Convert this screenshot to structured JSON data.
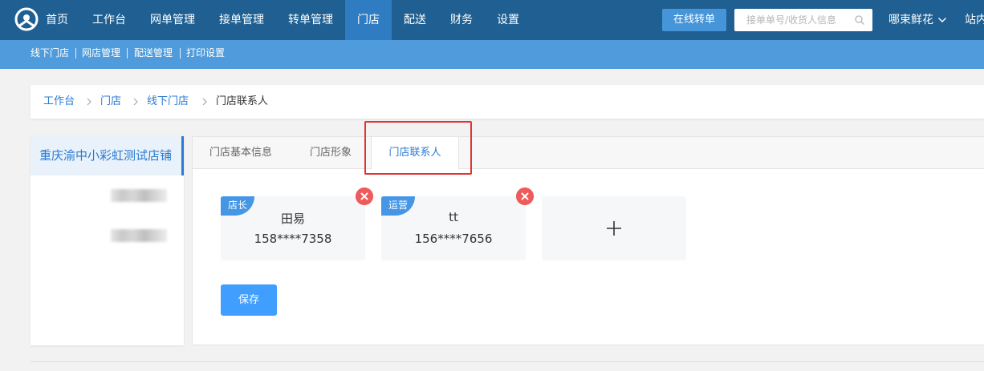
{
  "nav": {
    "items": [
      {
        "label": "首页"
      },
      {
        "label": "工作台"
      },
      {
        "label": "网单管理"
      },
      {
        "label": "接单管理"
      },
      {
        "label": "转单管理"
      },
      {
        "label": "门店",
        "active": true
      },
      {
        "label": "配送"
      },
      {
        "label": "财务"
      },
      {
        "label": "设置"
      }
    ],
    "online_transfer_button": "在线转单",
    "search": {
      "placeholder": "接单单号/收货人信息",
      "value": ""
    },
    "shop_name": "哪束鲜花",
    "station_label": "站内"
  },
  "subnav": {
    "items": [
      {
        "label": "线下门店"
      },
      {
        "label": "网店管理"
      },
      {
        "label": "配送管理"
      },
      {
        "label": "打印设置"
      }
    ]
  },
  "breadcrumb": [
    "工作台",
    "门店",
    "线下门店",
    "门店联系人"
  ],
  "store_list": {
    "selected_store": "重庆渝中小彩虹测试店铺"
  },
  "tabs": [
    {
      "label": "门店基本信息"
    },
    {
      "label": "门店形象"
    },
    {
      "label": "门店联系人",
      "active": true
    }
  ],
  "contacts": [
    {
      "role": "店长",
      "name": "田易",
      "phone": "158****7358"
    },
    {
      "role": "运营",
      "name": "tt",
      "phone": "156****7656"
    }
  ],
  "save_button": "保存",
  "colors": {
    "topbar": "#1f5f91",
    "subbar": "#4f9bdb",
    "accent": "#2a7ad1",
    "badge": "#4596e4",
    "delete": "#ee5b5b",
    "highlight": "#e3322f",
    "save": "#409eff"
  }
}
